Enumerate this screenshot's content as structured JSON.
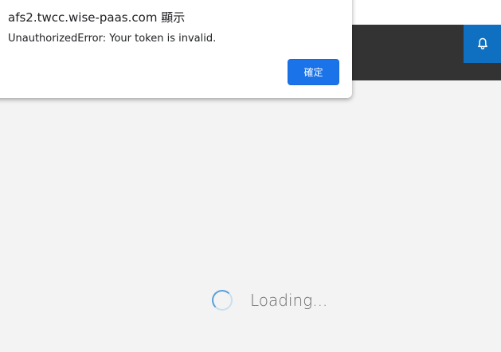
{
  "dialog": {
    "title": "afs2.twcc.wise-paas.com 顯示",
    "message": "UnauthorizedError: Your token is invalid.",
    "ok_label": "確定"
  },
  "header": {
    "bell_icon": "bell-icon"
  },
  "main": {
    "loading_text": "Loading..."
  },
  "colors": {
    "header_bg": "#333333",
    "accent": "#0f70c1",
    "button": "#1a73e8",
    "page_bg": "#f3f3f3"
  }
}
